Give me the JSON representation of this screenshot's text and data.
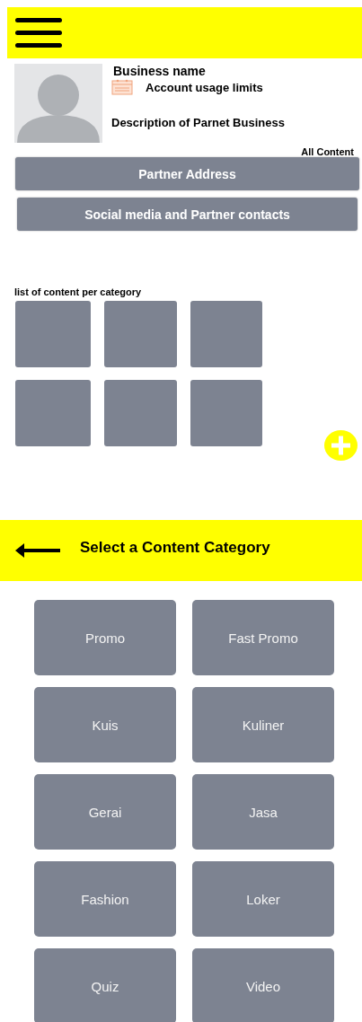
{
  "profile": {
    "business_name": "Business name",
    "usage_limits": "Account usage limits",
    "description": "Description of Parnet Business",
    "all_content": "All Content"
  },
  "buttons": [
    "Partner Address",
    "Social media and Partner contacts"
  ],
  "content_section": {
    "title": "list of content per category",
    "tiles": [
      {
        "kind": "tile"
      },
      {
        "kind": "tile"
      },
      {
        "kind": "tile"
      },
      {
        "kind": "tile"
      },
      {
        "kind": "tile"
      },
      {
        "kind": "tile"
      }
    ]
  },
  "category_screen": {
    "title": "Select a Content Category",
    "categories": [
      "Promo",
      "Fast Promo",
      "Kuis",
      "Kuliner",
      "Gerai",
      "Jasa",
      "Fashion",
      "Loker",
      "Quiz",
      "Video"
    ]
  }
}
